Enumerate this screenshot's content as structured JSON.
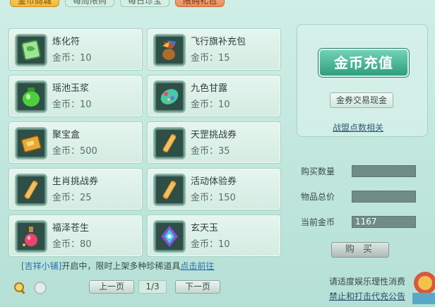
{
  "tabs": [
    {
      "label": "金币商城",
      "state": "active"
    },
    {
      "label": "每周限购",
      "state": "normal"
    },
    {
      "label": "每日珍宝",
      "state": "normal"
    },
    {
      "label": "限购礼包",
      "state": "gift"
    }
  ],
  "items": [
    {
      "name": "炼化符",
      "price": "金币：10",
      "icon": "talisman-icon"
    },
    {
      "name": "飞行旗补充包",
      "price": "金币：15",
      "icon": "flag-pack-icon"
    },
    {
      "name": "瑶池玉浆",
      "price": "金币：10",
      "icon": "jade-jar-icon"
    },
    {
      "name": "九色甘露",
      "price": "金币：10",
      "icon": "dewdrop-icon"
    },
    {
      "name": "聚宝盒",
      "price": "金币：500",
      "icon": "treasure-box-icon"
    },
    {
      "name": "天罡挑战券",
      "price": "金币：35",
      "icon": "scroll-icon"
    },
    {
      "name": "生肖挑战券",
      "price": "金币：25",
      "icon": "scroll-icon"
    },
    {
      "name": "活动体验券",
      "price": "金币：150",
      "icon": "scroll-icon"
    },
    {
      "name": "福泽苍生",
      "price": "金币：80",
      "icon": "potion-icon"
    },
    {
      "name": "玄天玉",
      "price": "金币：10",
      "icon": "jade-gem-icon"
    }
  ],
  "panel": {
    "recharge_label": "金币充值",
    "exchange_label": "金券交易现金",
    "alliance_label": "战盟点数相关"
  },
  "purchase": {
    "qty_label": "购买数量",
    "qty_value": "",
    "total_label": "物品总价",
    "total_value": "",
    "gold_label": "当前金币",
    "gold_value": "1167",
    "buy_label": "购 买"
  },
  "notice": {
    "tag": "[吉祥小铺]",
    "text": "开启中，限时上架多种珍稀道具",
    "link": "点击前往"
  },
  "pager": {
    "prev_label": "上一页",
    "page": "1/3",
    "next_label": "下一页"
  },
  "footer": {
    "line1": "请适度娱乐理性消费",
    "line2": "禁止和打击代充公告"
  }
}
